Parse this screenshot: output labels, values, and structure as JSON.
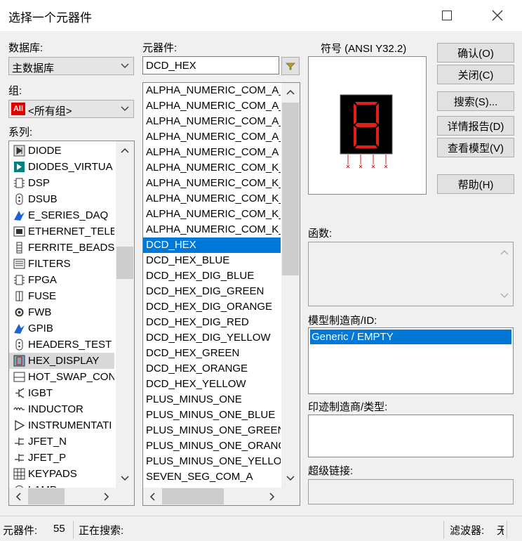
{
  "window": {
    "title": "选择一个元器件"
  },
  "database": {
    "label": "数据库:",
    "value": "主数据库"
  },
  "group": {
    "label": "组:",
    "icon_text": "All",
    "value": "<所有组>"
  },
  "family": {
    "label": "系列:",
    "items": [
      {
        "label": "DIODE",
        "icon": "diode-icon"
      },
      {
        "label": "DIODES_VIRTUA",
        "icon": "diode-virtual-icon"
      },
      {
        "label": "DSP",
        "icon": "chip-icon"
      },
      {
        "label": "DSUB",
        "icon": "connector-icon"
      },
      {
        "label": "E_SERIES_DAQ",
        "icon": "daq-icon"
      },
      {
        "label": "ETHERNET_TELE",
        "icon": "ethernet-icon"
      },
      {
        "label": "FERRITE_BEADS",
        "icon": "ferrite-icon"
      },
      {
        "label": "FILTERS",
        "icon": "filter-icon"
      },
      {
        "label": "FPGA",
        "icon": "chip-icon"
      },
      {
        "label": "FUSE",
        "icon": "fuse-icon"
      },
      {
        "label": "FWB",
        "icon": "gear-chip-icon"
      },
      {
        "label": "GPIB",
        "icon": "daq-icon"
      },
      {
        "label": "HEADERS_TEST",
        "icon": "connector-icon"
      },
      {
        "label": "HEX_DISPLAY",
        "icon": "hex-display-icon",
        "selected": true
      },
      {
        "label": "HOT_SWAP_CON",
        "icon": "hotswap-icon"
      },
      {
        "label": "IGBT",
        "icon": "transistor-icon"
      },
      {
        "label": "INDUCTOR",
        "icon": "inductor-icon"
      },
      {
        "label": "INSTRUMENTATI",
        "icon": "opamp-icon"
      },
      {
        "label": "JFET_N",
        "icon": "jfet-icon"
      },
      {
        "label": "JFET_P",
        "icon": "jfet-icon"
      },
      {
        "label": "KEYPADS",
        "icon": "keypad-icon"
      },
      {
        "label": "LAMP",
        "icon": "lamp-icon"
      }
    ]
  },
  "component": {
    "label": "元器件:",
    "value": "DCD_HEX",
    "filter_icon": "filter-funnel-icon",
    "items": [
      "ALPHA_NUMERIC_COM_A_",
      "ALPHA_NUMERIC_COM_A_",
      "ALPHA_NUMERIC_COM_A_",
      "ALPHA_NUMERIC_COM_A_",
      "ALPHA_NUMERIC_COM_A",
      "ALPHA_NUMERIC_COM_K_",
      "ALPHA_NUMERIC_COM_K_",
      "ALPHA_NUMERIC_COM_K_",
      "ALPHA_NUMERIC_COM_K_",
      "ALPHA_NUMERIC_COM_K_",
      "DCD_HEX",
      "DCD_HEX_BLUE",
      "DCD_HEX_DIG_BLUE",
      "DCD_HEX_DIG_GREEN",
      "DCD_HEX_DIG_ORANGE",
      "DCD_HEX_DIG_RED",
      "DCD_HEX_DIG_YELLOW",
      "DCD_HEX_GREEN",
      "DCD_HEX_ORANGE",
      "DCD_HEX_YELLOW",
      "PLUS_MINUS_ONE",
      "PLUS_MINUS_ONE_BLUE",
      "PLUS_MINUS_ONE_GREEN",
      "PLUS_MINUS_ONE_ORANGE",
      "PLUS_MINUS_ONE_YELLOW",
      "SEVEN_SEG_COM_A"
    ],
    "selected_index": 10
  },
  "symbol": {
    "label": "符号 (ANSI Y32.2)"
  },
  "buttons": {
    "ok": "确认(O)",
    "close": "关闭(C)",
    "search": "搜索(S)...",
    "detail_report": "详情报告(D)",
    "view_model": "查看模型(V)",
    "help": "帮助(H)"
  },
  "function": {
    "label": "函数:"
  },
  "model_mfr": {
    "label": "模型制造商/ID:",
    "items": [
      "Generic / EMPTY"
    ]
  },
  "footprint_mfr": {
    "label": "印迹制造商/类型:"
  },
  "hyperlink": {
    "label": "超级链接:"
  },
  "status": {
    "components_label": "元器件:",
    "components_count": "55",
    "searching_label": "正在搜索:",
    "filter_label": "滤波器:",
    "filter_value": "无"
  },
  "colors": {
    "selection": "#0078d7",
    "segment_red": "#e0201b",
    "all_icon_red": "#e00000"
  }
}
